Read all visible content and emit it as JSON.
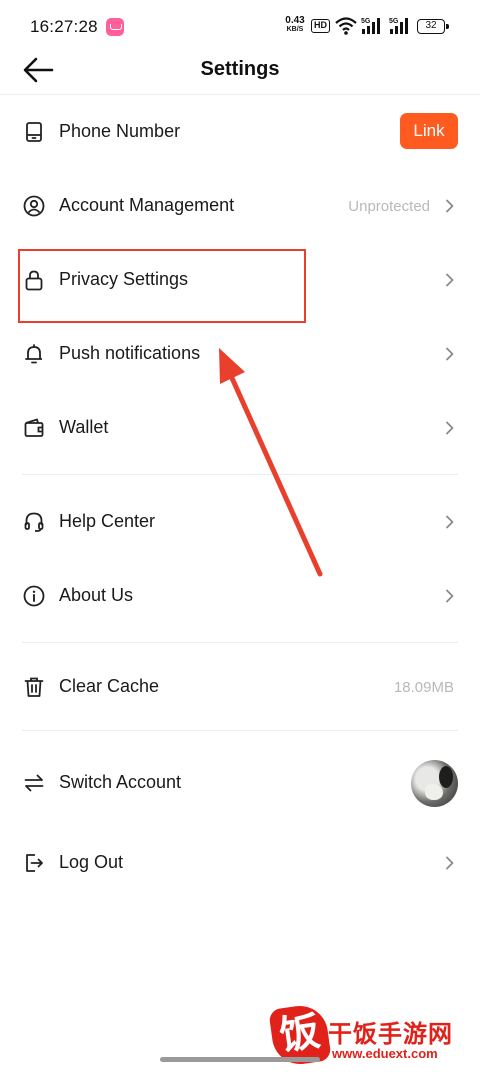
{
  "status_bar": {
    "time": "16:27:28",
    "net_speed_value": "0.43",
    "net_speed_unit": "KB/S",
    "hd_label": "HD",
    "signal_label_1": "5G",
    "signal_label_2": "5G",
    "battery_level": "32"
  },
  "header": {
    "title": "Settings",
    "back_icon": "arrow-left-icon"
  },
  "settings": {
    "phone_number": {
      "label": "Phone Number",
      "button_label": "Link",
      "icon": "phone-icon"
    },
    "account_management": {
      "label": "Account Management",
      "value": "Unprotected",
      "icon": "user-circle-icon"
    },
    "privacy_settings": {
      "label": "Privacy Settings",
      "icon": "lock-icon"
    },
    "push_notifications": {
      "label": "Push notifications",
      "icon": "bell-icon"
    },
    "wallet": {
      "label": "Wallet",
      "icon": "wallet-icon"
    },
    "help_center": {
      "label": "Help Center",
      "icon": "headset-icon"
    },
    "about_us": {
      "label": "About Us",
      "icon": "info-icon"
    },
    "clear_cache": {
      "label": "Clear Cache",
      "value": "18.09MB",
      "icon": "trash-icon"
    },
    "switch_account": {
      "label": "Switch Account",
      "icon": "switch-arrows-icon"
    },
    "log_out": {
      "label": "Log Out",
      "icon": "logout-icon"
    }
  },
  "watermark": {
    "logo_char": "饭",
    "title": "干饭手游网",
    "url": "www.eduext.com"
  },
  "colors": {
    "accent": "#ff5a1f",
    "annotation_red": "#e8402d",
    "muted_text": "#b9b9b9",
    "watermark_red": "#e0221a"
  }
}
